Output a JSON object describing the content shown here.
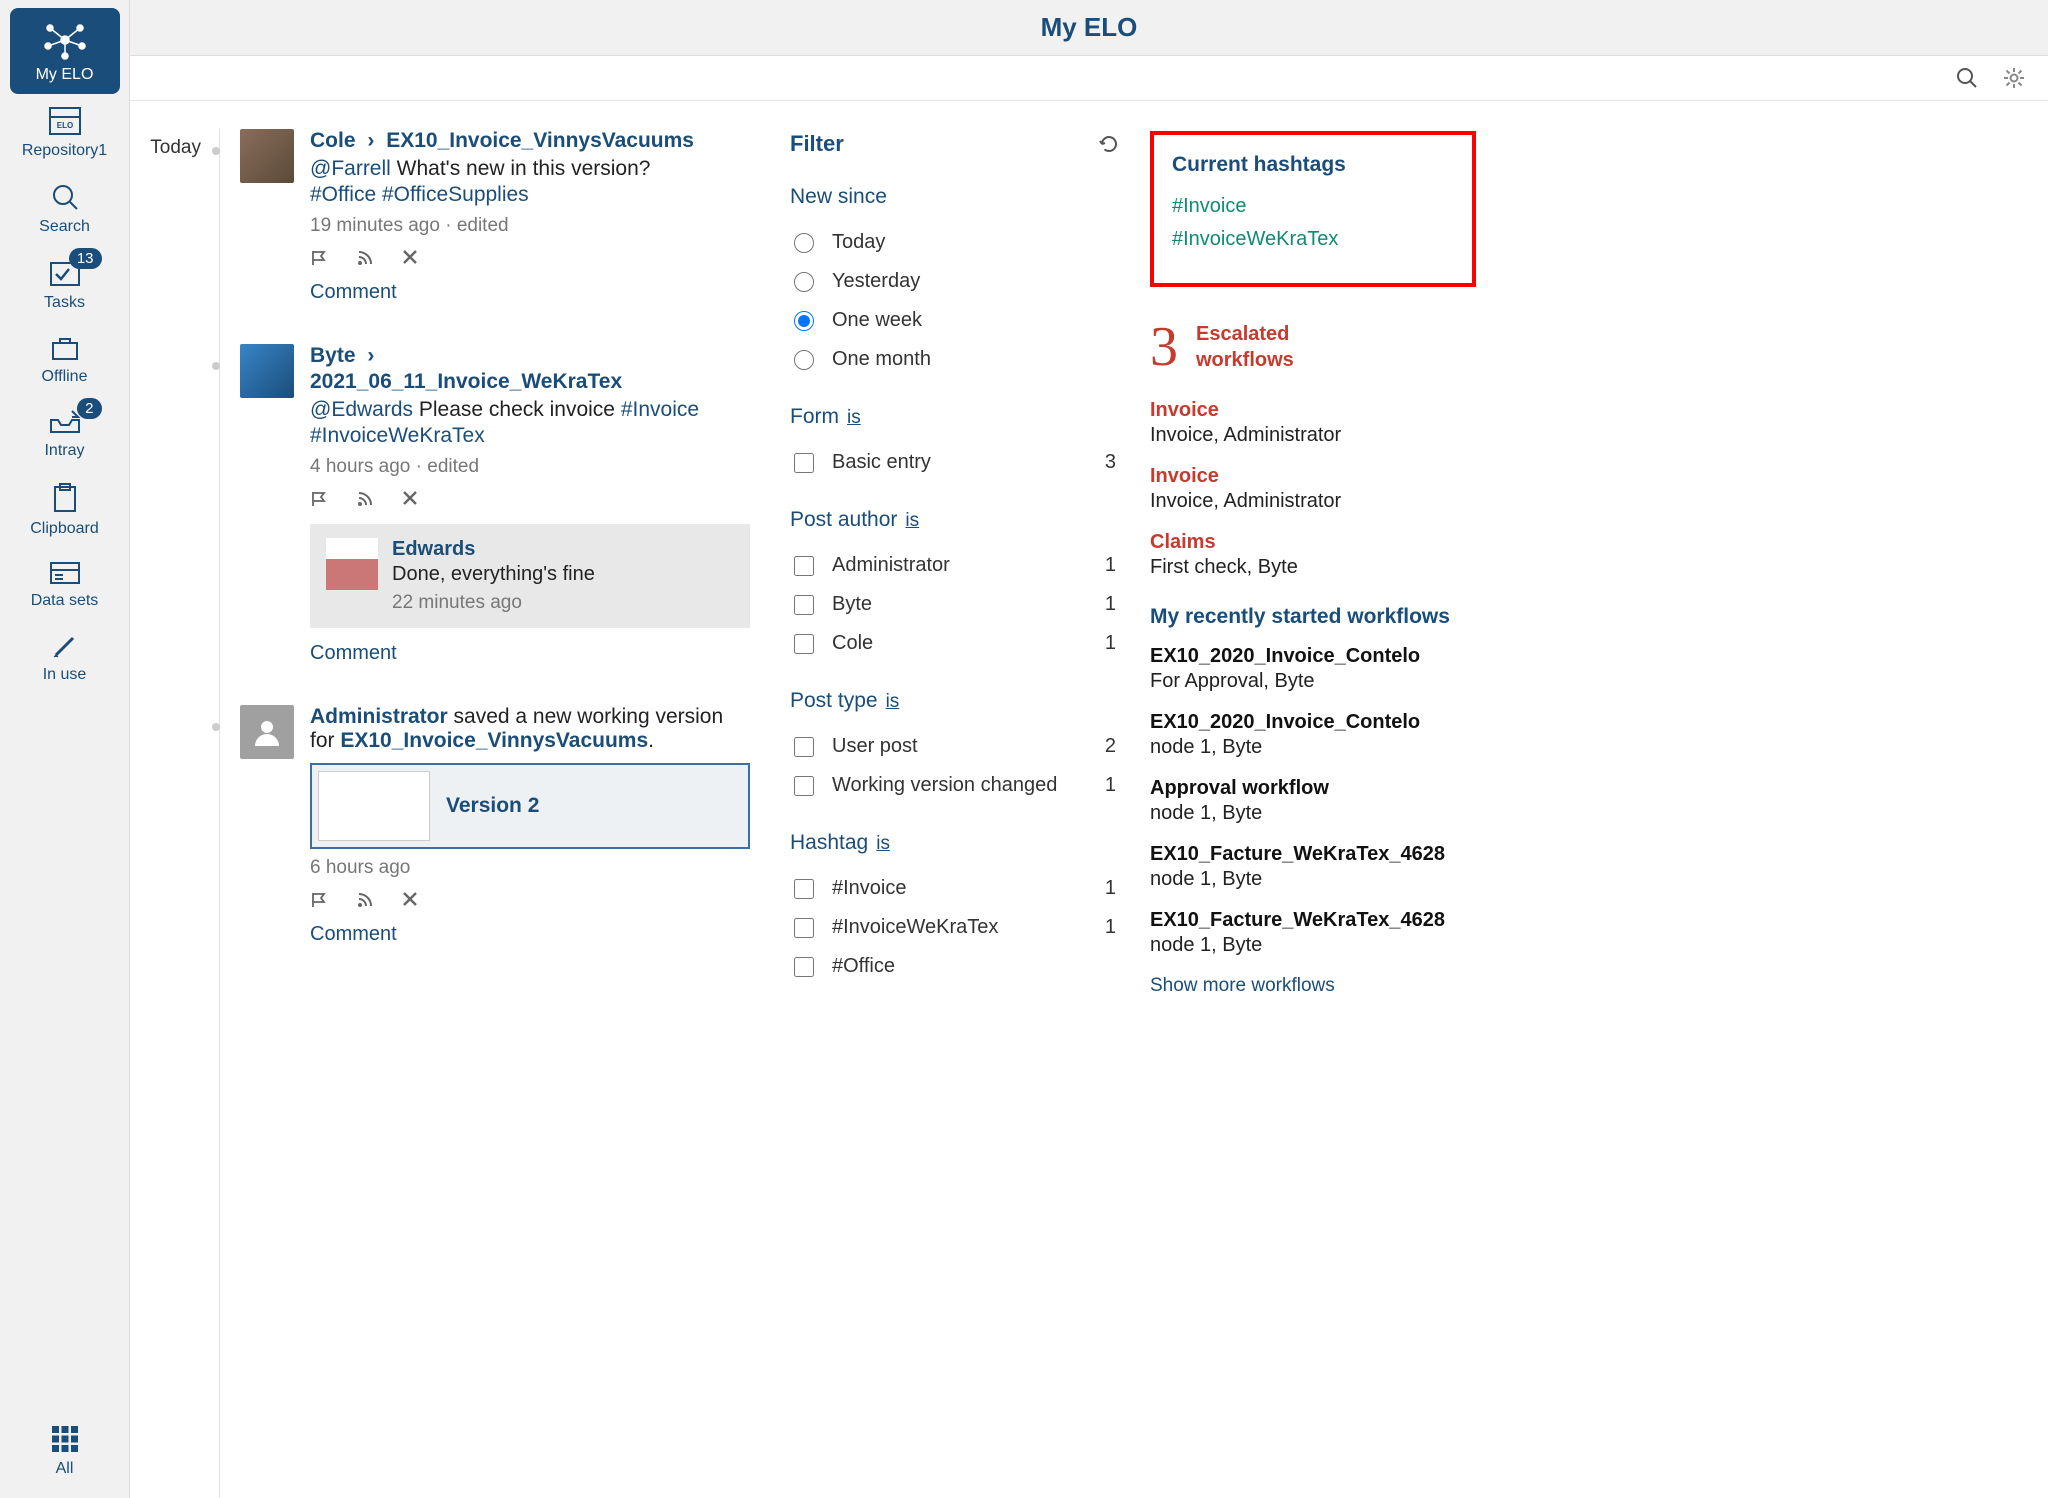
{
  "app": {
    "title": "My ELO"
  },
  "sidebar": {
    "items": [
      {
        "id": "myelo",
        "label": "My ELO"
      },
      {
        "id": "repository",
        "label": "Repository1"
      },
      {
        "id": "search",
        "label": "Search"
      },
      {
        "id": "tasks",
        "label": "Tasks",
        "badge": "13"
      },
      {
        "id": "offline",
        "label": "Offline"
      },
      {
        "id": "intray",
        "label": "Intray",
        "badge": "2"
      },
      {
        "id": "clipboard",
        "label": "Clipboard"
      },
      {
        "id": "datasets",
        "label": "Data sets"
      },
      {
        "id": "inuse",
        "label": "In use"
      }
    ],
    "bottom": {
      "label": "All"
    }
  },
  "feed": {
    "date": "Today",
    "posts": [
      {
        "author": "Cole",
        "doc": "EX10_Invoice_VinnysVacuums",
        "mention": "@Farrell",
        "text": "What's new in this version?",
        "tags": "#Office #OfficeSupplies",
        "time": "19 minutes ago",
        "edited": "edited",
        "comment": "Comment"
      },
      {
        "author": "Byte",
        "doc": "2021_06_11_Invoice_WeKraTex",
        "mention": "@Edwards",
        "text": "Please check invoice",
        "tag1": "#Invoice",
        "tag2": "#InvoiceWeKraTex",
        "time": "4 hours ago",
        "edited": "edited",
        "reply": {
          "name": "Edwards",
          "text": "Done, everything's fine",
          "time": "22 minutes ago"
        },
        "comment": "Comment"
      },
      {
        "author": "Administrator",
        "action_prefix": "saved a new working version for",
        "doc": "EX10_Invoice_VinnysVacuums",
        "version_label": "Version 2",
        "time": "6 hours ago",
        "comment": "Comment"
      }
    ]
  },
  "filter": {
    "title": "Filter",
    "newsince": {
      "title": "New since",
      "options": [
        "Today",
        "Yesterday",
        "One week",
        "One month"
      ],
      "selected": "One week"
    },
    "form": {
      "title": "Form",
      "is": "is",
      "items": [
        {
          "label": "Basic entry",
          "count": "3"
        }
      ]
    },
    "postauthor": {
      "title": "Post author",
      "is": "is",
      "items": [
        {
          "label": "Administrator",
          "count": "1"
        },
        {
          "label": "Byte",
          "count": "1"
        },
        {
          "label": "Cole",
          "count": "1"
        }
      ]
    },
    "posttype": {
      "title": "Post type",
      "is": "is",
      "items": [
        {
          "label": "User post",
          "count": "2"
        },
        {
          "label": "Working version changed",
          "count": "1"
        }
      ]
    },
    "hashtag": {
      "title": "Hashtag",
      "is": "is",
      "items": [
        {
          "label": "#Invoice",
          "count": "1"
        },
        {
          "label": "#InvoiceWeKraTex",
          "count": "1"
        },
        {
          "label": "#Office",
          "count": ""
        }
      ]
    }
  },
  "right": {
    "hashtags": {
      "title": "Current hashtags",
      "items": [
        "#Invoice",
        "#InvoiceWeKraTex"
      ]
    },
    "escalated": {
      "count": "3",
      "label_line1": "Escalated",
      "label_line2": "workflows",
      "items": [
        {
          "title": "Invoice",
          "sub": "Invoice, Administrator"
        },
        {
          "title": "Invoice",
          "sub": "Invoice, Administrator"
        },
        {
          "title": "Claims",
          "sub": "First check, Byte"
        }
      ]
    },
    "recent": {
      "title": "My recently started workflows",
      "items": [
        {
          "title": "EX10_2020_Invoice_Contelo",
          "sub": "For Approval, Byte"
        },
        {
          "title": "EX10_2020_Invoice_Contelo",
          "sub": "node 1, Byte"
        },
        {
          "title": "Approval workflow",
          "sub": "node 1, Byte"
        },
        {
          "title": "EX10_Facture_WeKraTex_4628",
          "sub": "node 1, Byte"
        },
        {
          "title": "EX10_Facture_WeKraTex_4628",
          "sub": "node 1, Byte"
        }
      ],
      "more": "Show more workflows"
    }
  }
}
